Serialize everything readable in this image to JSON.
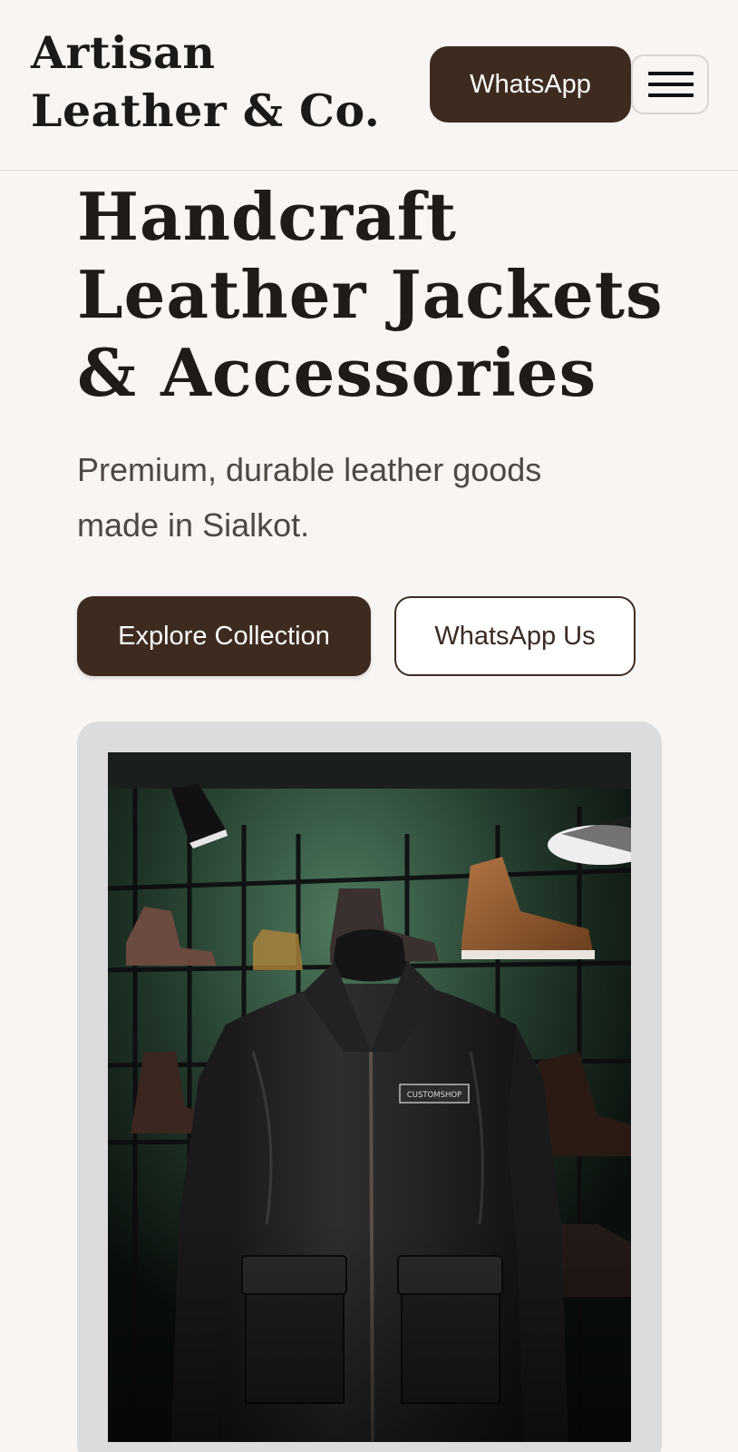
{
  "header": {
    "brand": "Artisan Leather & Co.",
    "whatsapp_label": "WhatsApp",
    "menu_icon": "hamburger-menu-icon"
  },
  "hero": {
    "title": "Handcraft Leather Jackets & Accessories",
    "subtitle": "Premium, durable leather goods made in Sialkot.",
    "primary_cta": "Explore Collection",
    "secondary_cta": "WhatsApp Us"
  },
  "image": {
    "patch_text": "CUSTOMSHOP"
  },
  "colors": {
    "background": "#f8f5f2",
    "brand_brown": "#3e2b20",
    "text_dark": "#1f1b18",
    "text_muted": "#4e4844"
  }
}
